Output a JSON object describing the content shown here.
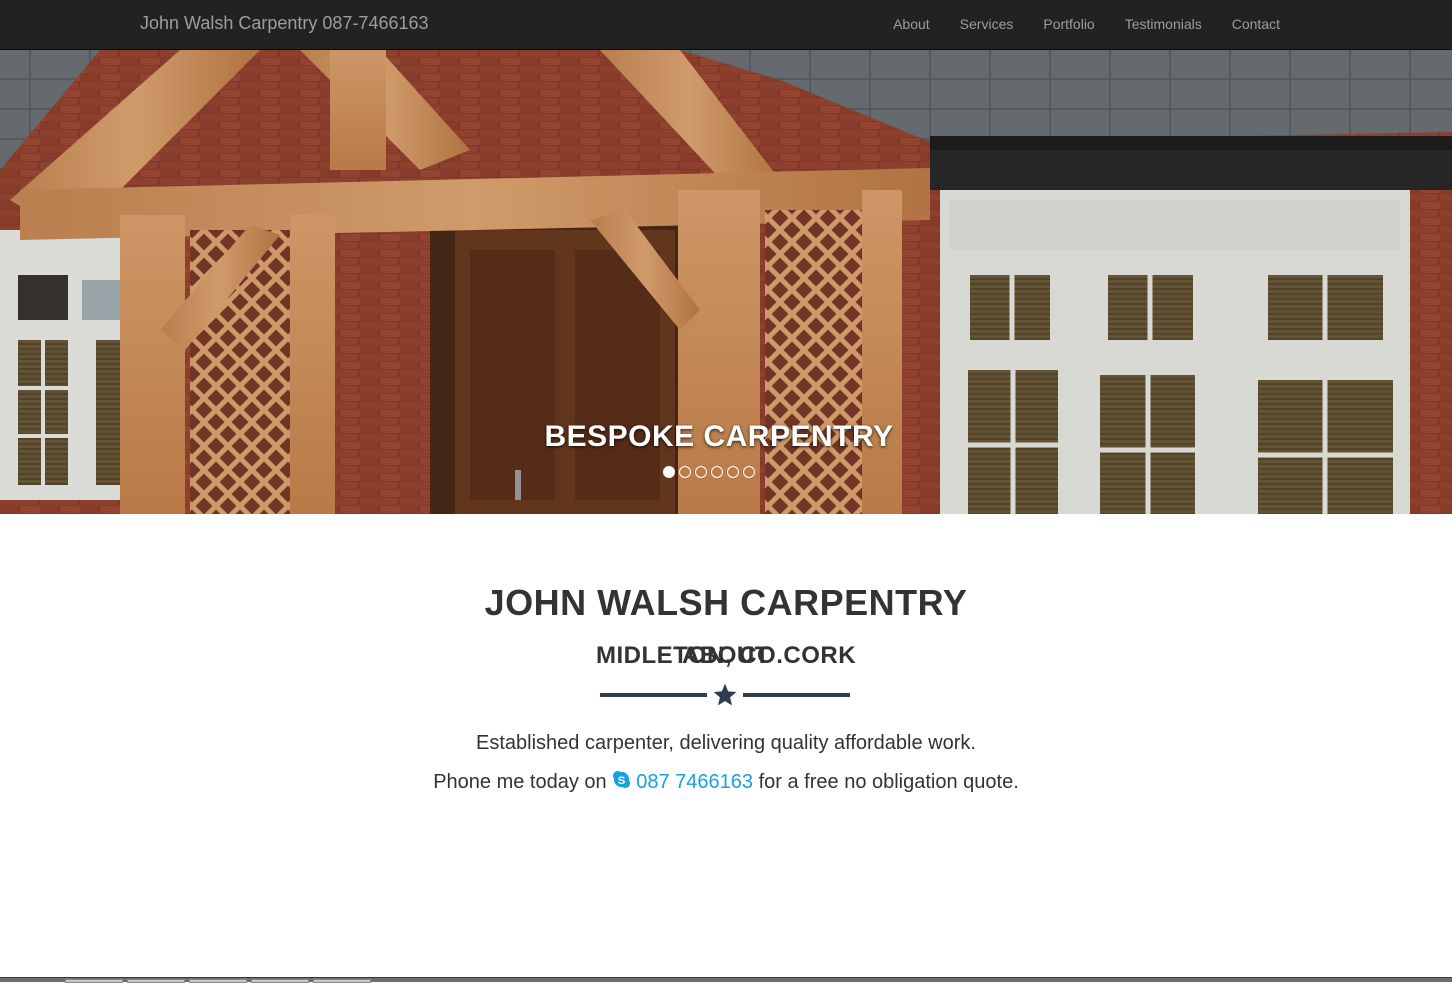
{
  "navbar": {
    "brand": "John Walsh Carpentry 087-7466163",
    "links": [
      "About",
      "Services",
      "Portfolio",
      "Testimonials",
      "Contact"
    ]
  },
  "hero": {
    "caption": "BESPOKE CARPENTRY",
    "slide_count": 6,
    "active_slide": 1
  },
  "intro": {
    "title": "JOHN WALSH CARPENTRY",
    "subtitle": "MIDLETON, CO.CORK",
    "line1": "Established carpenter, delivering quality affordable work.",
    "line2_before": "Phone me today on",
    "phone": "087 7466163",
    "line2_after": "for a free no obligation quote."
  },
  "about": {
    "title": "ABOUT"
  },
  "colors": {
    "navbar_bg": "#222222",
    "nav_text": "#9d9d9d",
    "heading": "#333333",
    "divider": "#2c3e50",
    "link": "#18a0e0"
  },
  "icons": {
    "divider": "star-icon",
    "phone": "skype-icon"
  }
}
